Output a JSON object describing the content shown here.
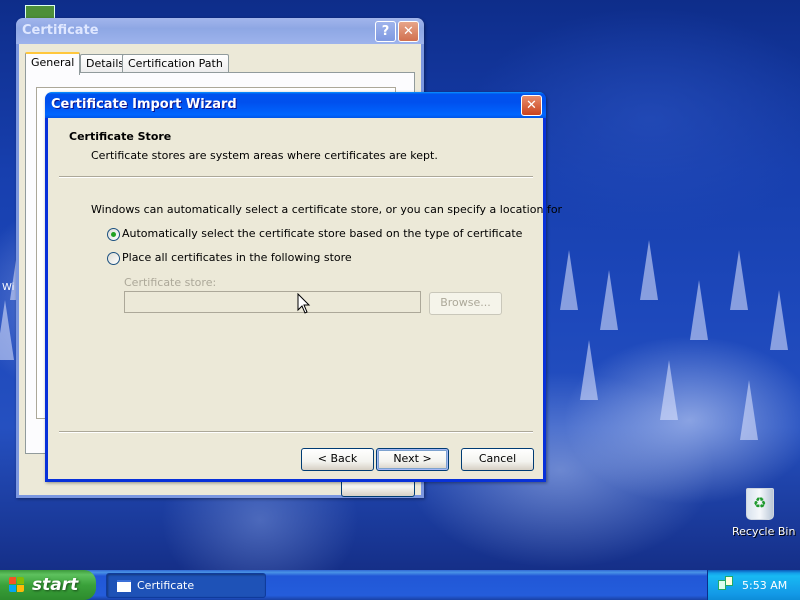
{
  "desktop": {
    "recycle_bin_label": "Recycle Bin",
    "left_icon_partial_label": "Wi"
  },
  "cert_window": {
    "title": "Certificate",
    "tabs": [
      {
        "label": "General",
        "active": true
      },
      {
        "label": "Details",
        "active": false
      },
      {
        "label": "Certification Path",
        "active": false
      }
    ],
    "help_symbol": "?",
    "close_symbol": "✕"
  },
  "wizard": {
    "title": "Certificate Import Wizard",
    "close_symbol": "✕",
    "header_title": "Certificate Store",
    "header_desc": "Certificate stores are system areas where certificates are kept.",
    "intro": "Windows can automatically select a certificate store, or you can specify a location for",
    "options": [
      {
        "label": "Automatically select the certificate store based on the type of certificate",
        "checked": true
      },
      {
        "label": "Place all certificates in the following store",
        "checked": false
      }
    ],
    "store_label": "Certificate store:",
    "store_value": "",
    "browse_label": "Browse...",
    "back_label": "< Back",
    "next_label": "Next >",
    "cancel_label": "Cancel"
  },
  "taskbar": {
    "start_label": "start",
    "task_title": "Certificate",
    "clock": "5:53 AM"
  },
  "colors": {
    "titlebar_active": "#0054e3",
    "dialog_face": "#ece9d8",
    "start_green": "#3aa13a",
    "taskbar_blue": "#245ddb",
    "radio_dot": "#21a121"
  }
}
